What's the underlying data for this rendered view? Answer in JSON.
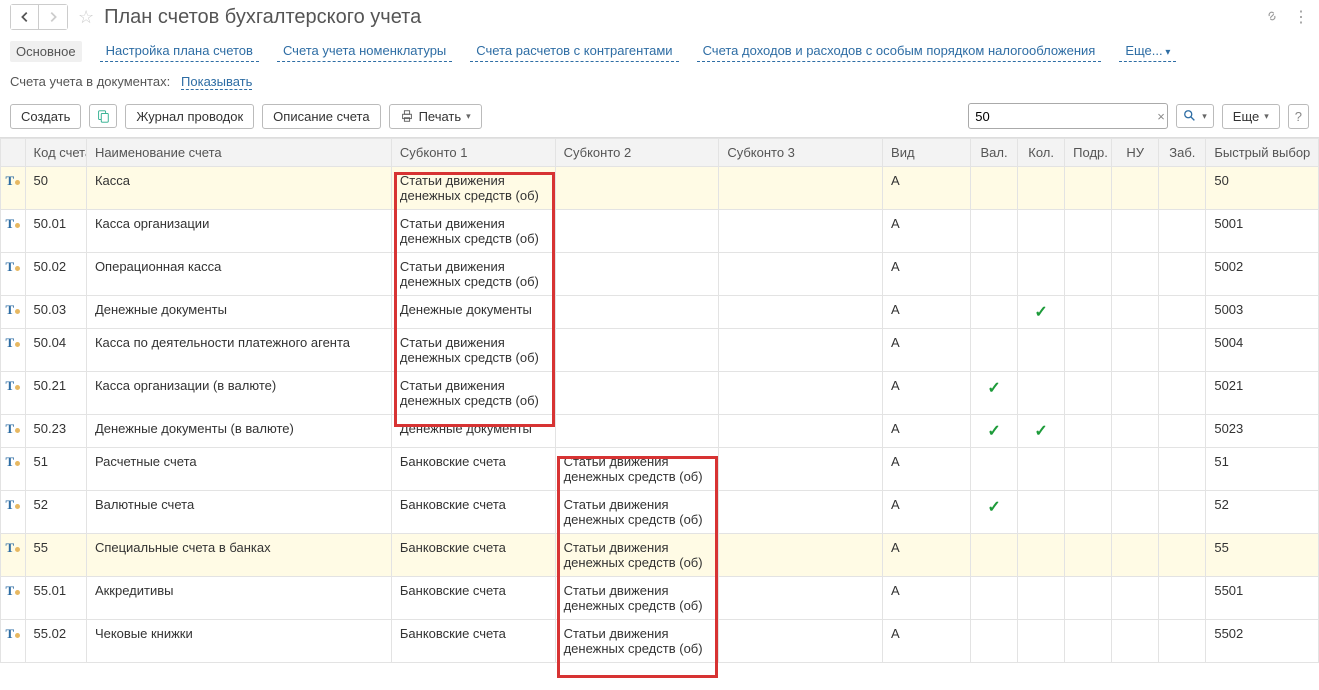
{
  "header": {
    "title": "План счетов бухгалтерского учета"
  },
  "tabs": {
    "main": "Основное",
    "t1": "Настройка плана счетов",
    "t2": "Счета учета номенклатуры",
    "t3": "Счета расчетов с контрагентами",
    "t4": "Счета доходов и расходов с особым порядком налогообложения",
    "more": "Еще..."
  },
  "subline": {
    "label": "Счета учета в документах:",
    "link": "Показывать"
  },
  "toolbar": {
    "create": "Создать",
    "journal": "Журнал проводок",
    "desc": "Описание счета",
    "print": "Печать",
    "more": "Еще",
    "search_value": "50"
  },
  "columns": {
    "code": "Код счета",
    "name": "Наименование счета",
    "sub1": "Субконто 1",
    "sub2": "Субконто 2",
    "sub3": "Субконто 3",
    "vid": "Вид",
    "val": "Вал.",
    "kol": "Кол.",
    "podr": "Подр.",
    "nu": "НУ",
    "zab": "Заб.",
    "fast": "Быстрый выбор"
  },
  "rows": [
    {
      "hl": true,
      "code": "50",
      "name": "Касса",
      "s1": "Статьи движения денежных средств (об)",
      "s2": "",
      "s3": "",
      "vid": "А",
      "val": "",
      "kol": "",
      "fast": "50"
    },
    {
      "hl": false,
      "code": "50.01",
      "name": "Касса организации",
      "s1": "Статьи движения денежных средств (об)",
      "s2": "",
      "s3": "",
      "vid": "А",
      "val": "",
      "kol": "",
      "fast": "5001"
    },
    {
      "hl": false,
      "code": "50.02",
      "name": "Операционная касса",
      "s1": "Статьи движения денежных средств (об)",
      "s2": "",
      "s3": "",
      "vid": "А",
      "val": "",
      "kol": "",
      "fast": "5002"
    },
    {
      "hl": false,
      "code": "50.03",
      "name": "Денежные документы",
      "s1": "Денежные документы",
      "s2": "",
      "s3": "",
      "vid": "А",
      "val": "",
      "kol": "✓",
      "fast": "5003"
    },
    {
      "hl": false,
      "code": "50.04",
      "name": "Касса по деятельности платежного агента",
      "s1": "Статьи движения денежных средств (об)",
      "s2": "",
      "s3": "",
      "vid": "А",
      "val": "",
      "kol": "",
      "fast": "5004"
    },
    {
      "hl": false,
      "code": "50.21",
      "name": "Касса организации (в валюте)",
      "s1": "Статьи движения денежных средств (об)",
      "s2": "",
      "s3": "",
      "vid": "А",
      "val": "✓",
      "kol": "",
      "fast": "5021"
    },
    {
      "hl": false,
      "code": "50.23",
      "name": "Денежные документы (в валюте)",
      "s1": "Денежные документы",
      "s2": "",
      "s3": "",
      "vid": "А",
      "val": "✓",
      "kol": "✓",
      "fast": "5023"
    },
    {
      "hl": false,
      "code": "51",
      "name": "Расчетные счета",
      "s1": "Банковские счета",
      "s2": "Статьи движения денежных средств (об)",
      "s3": "",
      "vid": "А",
      "val": "",
      "kol": "",
      "fast": "51"
    },
    {
      "hl": false,
      "code": "52",
      "name": "Валютные счета",
      "s1": "Банковские счета",
      "s2": "Статьи движения денежных средств (об)",
      "s3": "",
      "vid": "А",
      "val": "✓",
      "kol": "",
      "fast": "52"
    },
    {
      "hl": true,
      "code": "55",
      "name": "Специальные счета в банках",
      "s1": "Банковские счета",
      "s2": "Статьи движения денежных средств (об)",
      "s3": "",
      "vid": "А",
      "val": "",
      "kol": "",
      "fast": "55"
    },
    {
      "hl": false,
      "code": "55.01",
      "name": "Аккредитивы",
      "s1": "Банковские счета",
      "s2": "Статьи движения денежных средств (об)",
      "s3": "",
      "vid": "А",
      "val": "",
      "kol": "",
      "fast": "5501"
    },
    {
      "hl": false,
      "code": "55.02",
      "name": "Чековые книжки",
      "s1": "Банковские счета",
      "s2": "Статьи движения денежных средств (об)",
      "s3": "",
      "vid": "А",
      "val": "",
      "kol": "",
      "fast": "5502"
    }
  ]
}
